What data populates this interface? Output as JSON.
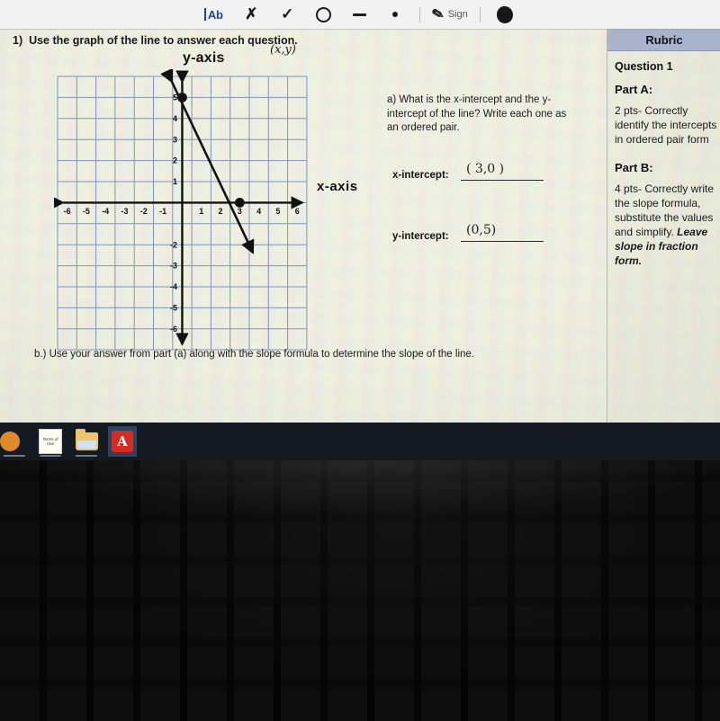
{
  "toolbar": {
    "tools": [
      {
        "name": "text-annotation-tool",
        "label": "Ab"
      },
      {
        "name": "cross-mark-tool",
        "label": "✗"
      },
      {
        "name": "check-mark-tool",
        "label": "✓"
      },
      {
        "name": "circle-tool",
        "label": "○"
      },
      {
        "name": "line-tool",
        "label": "—"
      },
      {
        "name": "dot-tool",
        "label": "•"
      }
    ],
    "sign_label": "Sign"
  },
  "document": {
    "question_number": "1)",
    "question_text": "Use the graph of the line to answer each question.",
    "y_axis_label": "y-axis",
    "x_axis_label": "x-axis",
    "ordered_pair_note": "(x,y)",
    "part_a": {
      "prompt": "a) What is the x-intercept and the y-intercept of the line? Write each one as an ordered pair.",
      "x_intercept_label": "x-intercept:",
      "x_intercept_answer": "( 3,0 )",
      "y_intercept_label": "y-intercept:",
      "y_intercept_answer": "(0,5)"
    },
    "part_b": {
      "prompt": "b.) Use your answer from part (a) along with the slope formula to determine the slope of the line."
    }
  },
  "chart_data": {
    "type": "line",
    "title": "",
    "xlabel": "x-axis",
    "ylabel": "y-axis",
    "xlim": [
      -6.5,
      6.5
    ],
    "ylim": [
      -6.5,
      6.5
    ],
    "xticks": [
      -6,
      -5,
      -4,
      -3,
      -2,
      -1,
      1,
      2,
      3,
      4,
      5,
      6
    ],
    "yticks": [
      5,
      4,
      3,
      2,
      1,
      -2,
      -3,
      -4,
      -5,
      -6
    ],
    "grid": true,
    "series": [
      {
        "name": "line",
        "points": [
          [
            0,
            5
          ],
          [
            3,
            0
          ]
        ],
        "marked_points": [
          [
            0,
            5
          ],
          [
            3,
            0
          ]
        ],
        "slope": "-5/3",
        "arrows": "both"
      }
    ]
  },
  "rubric": {
    "header": "Rubric",
    "question_title": "Question 1",
    "part_a_title": "Part A:",
    "part_a_text": "2 pts- Correctly identify the intercepts in ordered pair form",
    "part_b_title": "Part B:",
    "part_b_text_1": "4 pts- Correctly write the slope formula, substitute the values and simplify. ",
    "part_b_text_2": "Leave slope in fraction form."
  },
  "taskbar": {
    "items": [
      {
        "name": "taskbar-app-orange",
        "label": ""
      },
      {
        "name": "taskbar-terms-of-use-doc",
        "label": "Terms of Use"
      },
      {
        "name": "taskbar-folder",
        "label": ""
      },
      {
        "name": "taskbar-adobe-pdf",
        "label": "A"
      }
    ]
  },
  "colors": {
    "rubric_header": "#aab3cc",
    "taskbar": "#151a22",
    "pdf_red": "#d82b20",
    "grid_blue": "#7e8fb8"
  }
}
